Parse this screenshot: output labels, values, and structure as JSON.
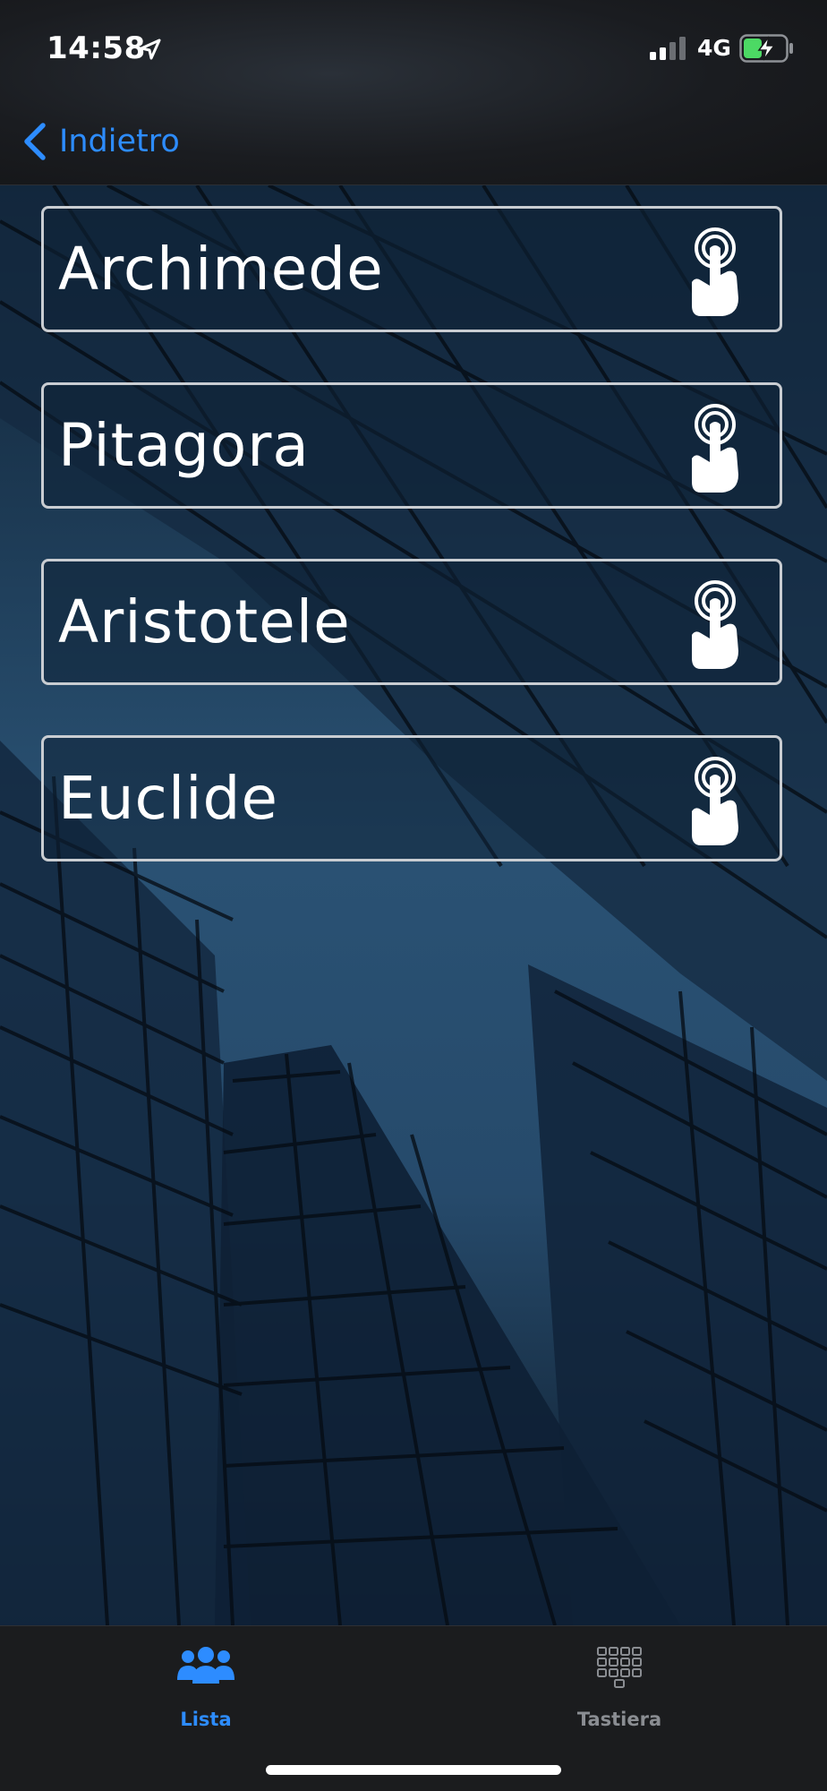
{
  "status_bar": {
    "time": "14:58",
    "network": "4G",
    "icons": [
      "location-arrow-icon",
      "cellular-signal-icon",
      "battery-charging-icon"
    ],
    "battery_color": "#4cd964"
  },
  "nav": {
    "back_label": "Indietro",
    "accent_color": "#2d8cff"
  },
  "items": [
    {
      "label": "Archimede",
      "icon": "tap-hand-icon"
    },
    {
      "label": "Pitagora",
      "icon": "tap-hand-icon"
    },
    {
      "label": "Aristotele",
      "icon": "tap-hand-icon"
    },
    {
      "label": "Euclide",
      "icon": "tap-hand-icon"
    }
  ],
  "tab_bar": {
    "tabs": [
      {
        "label": "Lista",
        "icon": "users-group-icon",
        "active": true
      },
      {
        "label": "Tastiera",
        "icon": "keypad-icon",
        "active": false
      }
    ]
  }
}
